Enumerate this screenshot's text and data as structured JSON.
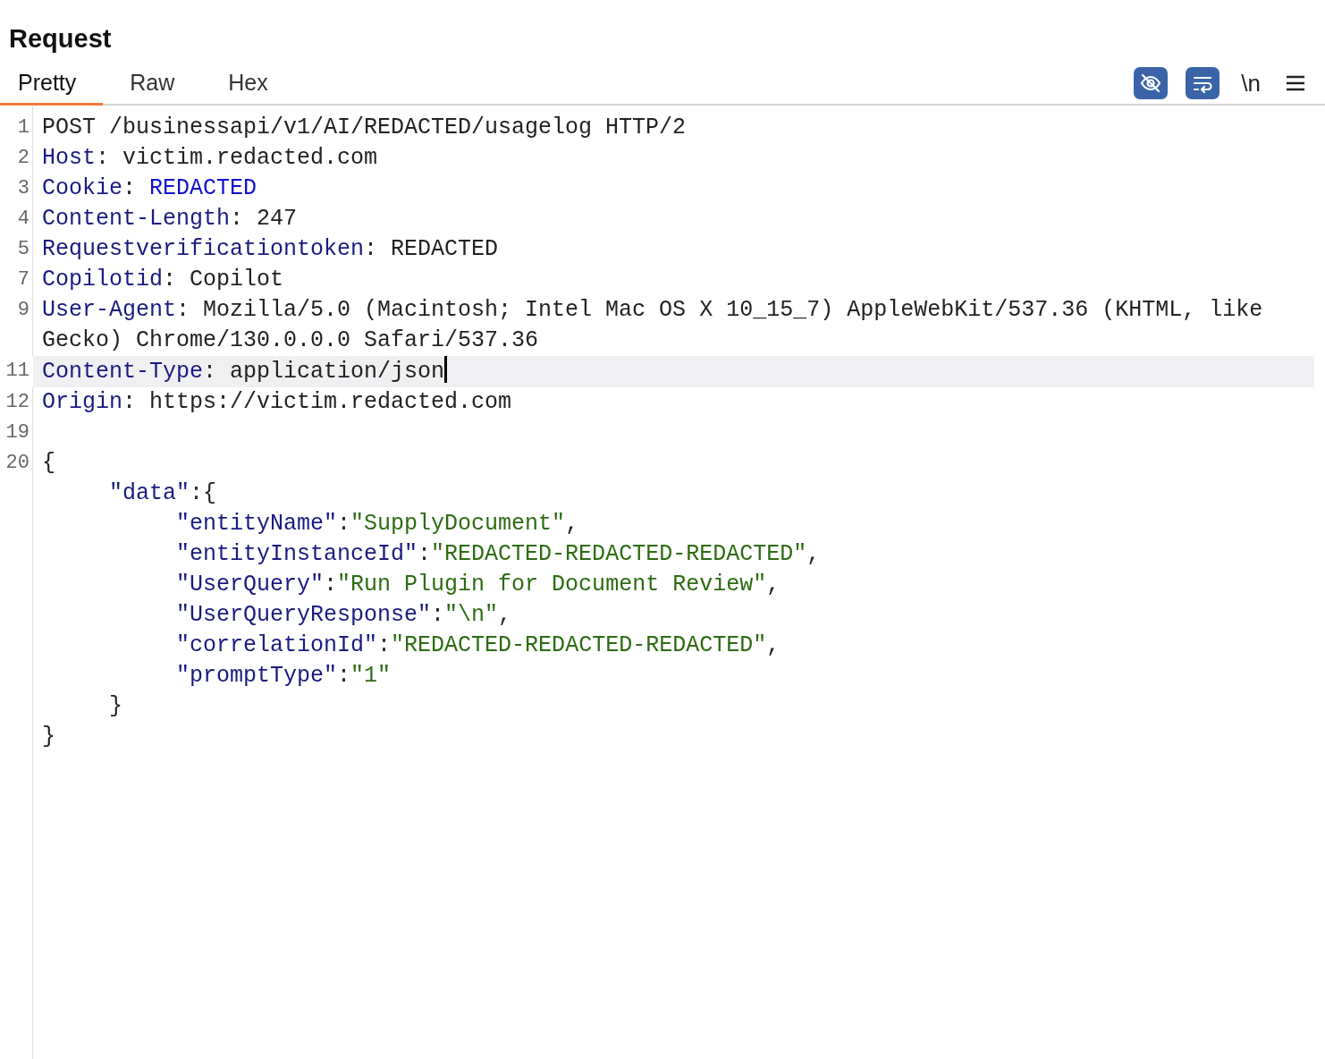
{
  "panel": {
    "title": "Request"
  },
  "tabs": [
    {
      "label": "Pretty",
      "selected": true
    },
    {
      "label": "Raw",
      "selected": false
    },
    {
      "label": "Hex",
      "selected": false
    }
  ],
  "toolbar": [
    {
      "kind": "hide",
      "on": true
    },
    {
      "kind": "wrap",
      "on": true
    },
    {
      "kind": "newline",
      "label": "\\n",
      "on": false
    },
    {
      "kind": "menu"
    }
  ],
  "lines": [
    {
      "number": "1",
      "highlighted": false,
      "tokens": [
        {
          "kind": "plain",
          "text": "POST /businessapi/v1/AI/REDACTED/usagelog HTTP/2"
        }
      ]
    },
    {
      "number": "2",
      "highlighted": false,
      "tokens": [
        {
          "kind": "key",
          "text": "Host"
        },
        {
          "kind": "plain",
          "text": ": victim.redacted.com"
        }
      ]
    },
    {
      "number": "3",
      "highlighted": false,
      "tokens": [
        {
          "kind": "key",
          "text": "Cookie"
        },
        {
          "kind": "plain",
          "text": ": "
        },
        {
          "kind": "cookie",
          "text": "REDACTED"
        }
      ]
    },
    {
      "number": "4",
      "highlighted": false,
      "tokens": [
        {
          "kind": "key",
          "text": "Content-Length"
        },
        {
          "kind": "plain",
          "text": ": 247"
        }
      ]
    },
    {
      "number": "5",
      "highlighted": false,
      "tokens": [
        {
          "kind": "key",
          "text": "Requestverificationtoken"
        },
        {
          "kind": "plain",
          "text": ": REDACTED"
        }
      ]
    },
    {
      "number": "7",
      "highlighted": false,
      "tokens": [
        {
          "kind": "key",
          "text": "Copilotid"
        },
        {
          "kind": "plain",
          "text": ": Copilot"
        }
      ]
    },
    {
      "number": "9",
      "highlighted": false,
      "tokens": [
        {
          "kind": "key",
          "text": "User-Agent"
        },
        {
          "kind": "plain",
          "text": ": Mozilla/5.0 (Macintosh; Intel Mac OS X 10_15_7) AppleWebKit/537.36 (KHTML, like Gecko) Chrome/130.0.0.0 Safari/537.36"
        }
      ]
    },
    {
      "number": "11",
      "highlighted": true,
      "cursor": true,
      "tokens": [
        {
          "kind": "key",
          "text": "Content-Type"
        },
        {
          "kind": "plain",
          "text": ": application/json"
        }
      ]
    },
    {
      "number": "12",
      "highlighted": false,
      "tokens": [
        {
          "kind": "key",
          "text": "Origin"
        },
        {
          "kind": "plain",
          "text": ": https://victim.redacted.com"
        }
      ]
    },
    {
      "number": "19",
      "highlighted": false
    },
    {
      "number": "20",
      "highlighted": false,
      "tokens": [
        {
          "kind": "plain",
          "text": "{"
        }
      ]
    },
    {
      "highlighted": false,
      "tokens": [
        {
          "kind": "key",
          "text": "     \"data\""
        },
        {
          "kind": "plain",
          "text": ":{"
        }
      ]
    },
    {
      "highlighted": false,
      "tokens": [
        {
          "kind": "key",
          "text": "          \"entityName\""
        },
        {
          "kind": "plain",
          "text": ":"
        },
        {
          "kind": "string",
          "text": "\"SupplyDocument\""
        },
        {
          "kind": "plain",
          "text": ","
        }
      ]
    },
    {
      "highlighted": false,
      "tokens": [
        {
          "kind": "key",
          "text": "          \"entityInstanceId\""
        },
        {
          "kind": "plain",
          "text": ":"
        },
        {
          "kind": "string",
          "text": "\"REDACTED-REDACTED-REDACTED\""
        },
        {
          "kind": "plain",
          "text": ","
        }
      ]
    },
    {
      "highlighted": false,
      "tokens": [
        {
          "kind": "key",
          "text": "          \"UserQuery\""
        },
        {
          "kind": "plain",
          "text": ":"
        },
        {
          "kind": "string",
          "text": "\"Run Plugin for Document Review\""
        },
        {
          "kind": "plain",
          "text": ","
        }
      ]
    },
    {
      "highlighted": false,
      "tokens": [
        {
          "kind": "key",
          "text": "          \"UserQueryResponse\""
        },
        {
          "kind": "plain",
          "text": ":"
        },
        {
          "kind": "string",
          "text": "\"\\n\""
        },
        {
          "kind": "plain",
          "text": ","
        }
      ]
    },
    {
      "highlighted": false,
      "tokens": [
        {
          "kind": "key",
          "text": "          \"correlationId\""
        },
        {
          "kind": "plain",
          "text": ":"
        },
        {
          "kind": "string",
          "text": "\"REDACTED-REDACTED-REDACTED\""
        },
        {
          "kind": "plain",
          "text": ","
        }
      ]
    },
    {
      "highlighted": false,
      "tokens": [
        {
          "kind": "key",
          "text": "          \"promptType\""
        },
        {
          "kind": "plain",
          "text": ":"
        },
        {
          "kind": "string",
          "text": "\"1\""
        }
      ]
    },
    {
      "highlighted": false,
      "tokens": [
        {
          "kind": "plain",
          "text": "     }"
        }
      ]
    },
    {
      "highlighted": false,
      "tokens": [
        {
          "kind": "plain",
          "text": "}"
        }
      ]
    }
  ]
}
